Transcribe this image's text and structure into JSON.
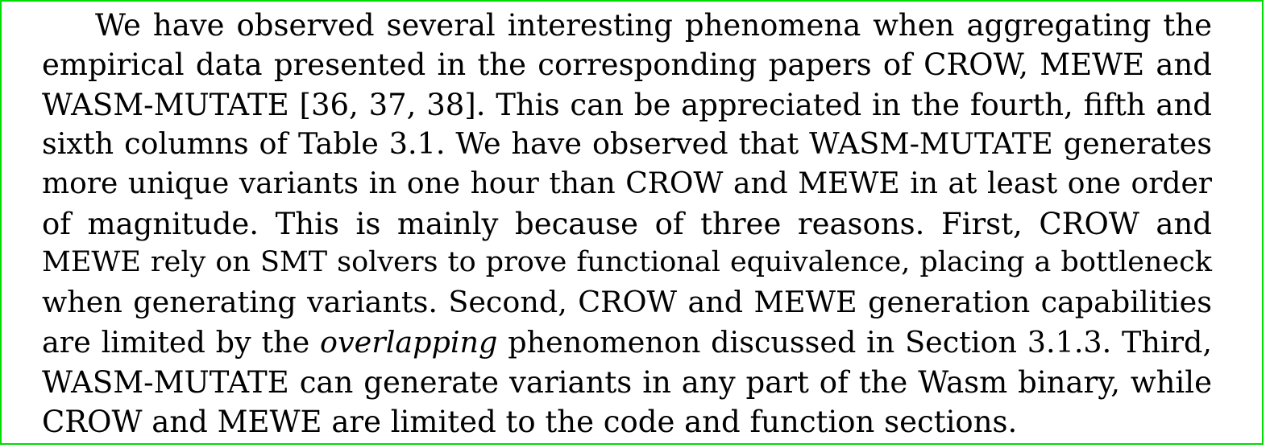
{
  "paragraph": {
    "line_1": "We have observed several interesting phenomena when aggregating the",
    "line_2": "empirical data presented in the corresponding papers of CROW, MEWE and",
    "line_3": "WASM-MUTATE [36, 37, 38].  This can be appreciated in the fourth, fifth and",
    "line_4": "sixth columns of Table 3.1.  We have observed that WASM-MUTATE generates",
    "line_5": "more unique variants in one hour than CROW and MEWE in at least one order",
    "line_6": "of magnitude.  This is mainly because of three reasons.  First, CROW and",
    "line_7": "MEWE rely on SMT solvers to prove functional equivalence, placing a bottleneck",
    "line_8": "when generating variants.  Second, CROW and MEWE generation capabilities",
    "line_9_before": "are limited by the",
    "line_9_emph": "overlapping",
    "line_9_after": "phenomenon discussed in Section 3.1.3.  Third,",
    "line_10": "WASM-MUTATE can generate variants in any part of the Wasm binary, while",
    "line_11": "CROW and MEWE are limited to the code and function sections."
  }
}
